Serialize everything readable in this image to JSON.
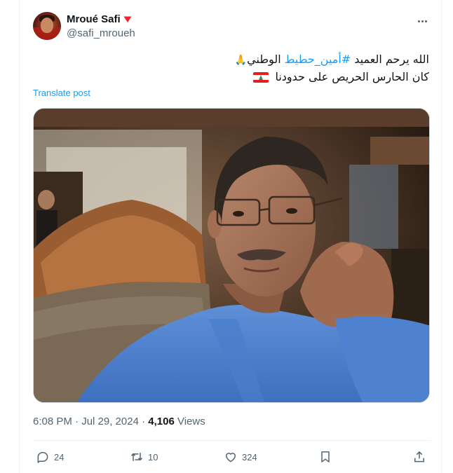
{
  "tweet": {
    "author": {
      "display_name": "Mroué Safi",
      "handle": "@safi_mroueh",
      "badge_icon": "heart-icon",
      "badge_color": "#f4212e"
    },
    "text_line1_prefix": "الله يرحم العميد ",
    "hashtag": "#أمين_حطيط",
    "text_line1_suffix": " الوطني",
    "text_line1_emoji": "🙏",
    "text_line2": "كان الحارس الحريص على حدودنا",
    "text_line2_flag": "lebanon-flag-icon",
    "translate_label": "Translate post",
    "timestamp": "6:08 PM · Jul 29, 2024 · ",
    "views_count": "4,106",
    "views_label": " Views",
    "actions": {
      "replies": "24",
      "reposts": "10",
      "likes": "324"
    }
  },
  "colors": {
    "accent": "#1d9bf0",
    "muted": "#536471",
    "text": "#0f1419"
  }
}
